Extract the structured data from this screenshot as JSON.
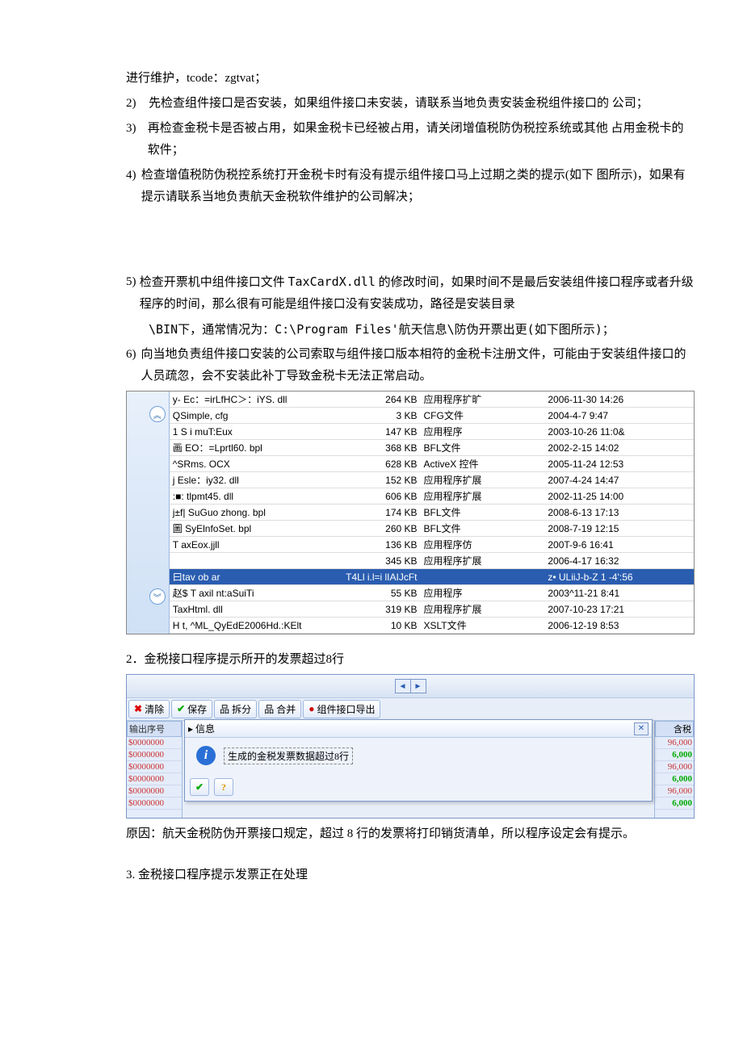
{
  "p": {
    "maint": "进行维护，tcode：zgtvat；",
    "n2": "2)",
    "t2": "先检查组件接口是否安装，如果组件接口未安装，请联系当地负责安装金税组件接口的 公司；",
    "n3": "3)",
    "t3": " 再检查金税卡是否被占用，如果金税卡已经被占用，请关闭增值税防伪税控系统或其他 占用金税卡的软件；",
    "n4": "4)",
    "t4": "检查增值税防伪税控系统打开金税卡时有没有提示组件接口马上过期之类的提示(如下 图所示)，如果有提示请联系当地负责航天金税软件维护的公司解决；",
    "n5": "5)",
    "t5a": " 检查开票机中组件接口文件 ",
    "t5file": "TaxCardX.dll",
    "t5b": " 的修改时间，如果时间不是最后安装组件接口程序或者升级程序的时间，那么很有可能是组件接口没有安装成功，路径是安装目录",
    "t5c": "\\BIN下，通常情况为：C:\\Program Files'航天信息\\防伪开票出更(如下图所示)；",
    "n6": "6)",
    "t6": " 向当地负责组件接口安装的公司索取与组件接口版本相符的金税卡注册文件，可能由于安装组件接口的人员疏忽，会不安装此补丁导致金税卡无法正常启动。",
    "s2t": "2．金税接口程序提示所开的发票超过8行",
    "cause": "原因：航天金税防伪开票接口规定，超过 8 行的发票将打印销货清单，所以程序设定会有提示。",
    "s3t": "3.   金税接口程序提示发票正在处理"
  },
  "files": [
    {
      "n": "y- Ec：=irLfHC＞：iYS. dll",
      "s": "264 KB",
      "t": "应用程序扩旷",
      "d": "2006-11-30 14:26"
    },
    {
      "n": "QSimple, cfg",
      "s": "3 KB",
      "t": "CFG文件",
      "d": "2004-4-7 9:47"
    },
    {
      "n": "1   S i muT:Eux",
      "s": "147 KB",
      "t": "应用程序",
      "d": "2003-10-26 11:0&"
    },
    {
      "n": "画 EO：=Lprtl60. bpl",
      "s": "368 KB",
      "t": "BFL文件",
      "d": "2002-2-15 14:02"
    },
    {
      "n": "^SRms. OCX",
      "s": "628 KB",
      "t": "ActiveX 控件",
      "d": "2005-11-24 12:53"
    },
    {
      "n": "j Esle：iy32. dll",
      "s": "152 KB",
      "t": "应用程序扩展",
      "d": "2007-4-24 14:47"
    },
    {
      "n": ":■: tlpmt45. dll",
      "s": "606  KB",
      "t": "应用程序扩展",
      "d": "2002-11-25 14:00"
    },
    {
      "n": "j±f| SuGuo zhong. bpl",
      "s": "174 KB",
      "t": "BFL文件",
      "d": "2008-6-13 17:13"
    },
    {
      "n": "圖  SyElnfoSet. bpl",
      "s": "260 KB",
      "t": "BFL文件",
      "d": "2008-7-19 12:15"
    },
    {
      "n": "    T axEox.jjll",
      "s": "136 KB",
      "t": "应用程序仿",
      "d": "200T-9-6 16:41"
    },
    {
      "n": "",
      "s": "345 KB",
      "t": "应用程序扩展",
      "d": "2006-4-17 16:32"
    },
    {
      "n": "曰tav ob ar",
      "s": "T4Ll   i.l=i   lIAIJcFt",
      "t": "",
      "d": "z• ULiiJ-b-Z 1 -4':56",
      "sel": true
    },
    {
      "n": "赵$  T axil nt:aSuiTi",
      "s": "55 KB",
      "t": "应用程序",
      "d": "2003^11-21 8:41"
    },
    {
      "n": "    TaxHtml. dll",
      "s": "319  KB",
      "t": "应用程序扩展",
      "d": "2007-10-23 17:21"
    },
    {
      "n": "H t, ^ML_QyEdE2006Hd.:KElt",
      "s": "10 KB",
      "t": "XSLT文件",
      "d": "2006-12-19 8:53"
    }
  ],
  "toolbar": {
    "clear": "清除",
    "save": "保存",
    "split": "拆分",
    "merge": "合并",
    "export": "组件接口导出"
  },
  "dlg": {
    "title": "信息",
    "msg": "生成的金税发票数据超过8行"
  },
  "left": {
    "hdr": "输出序号",
    "cells": [
      "$0000000",
      "$0000000",
      "$0000000",
      "$0000000",
      "$0000000",
      "$0000000"
    ]
  },
  "right": {
    "hdr": "含税",
    "cells": [
      "96,000",
      "6,000",
      "96,000",
      "6,000",
      "96,000",
      "6,000"
    ]
  }
}
